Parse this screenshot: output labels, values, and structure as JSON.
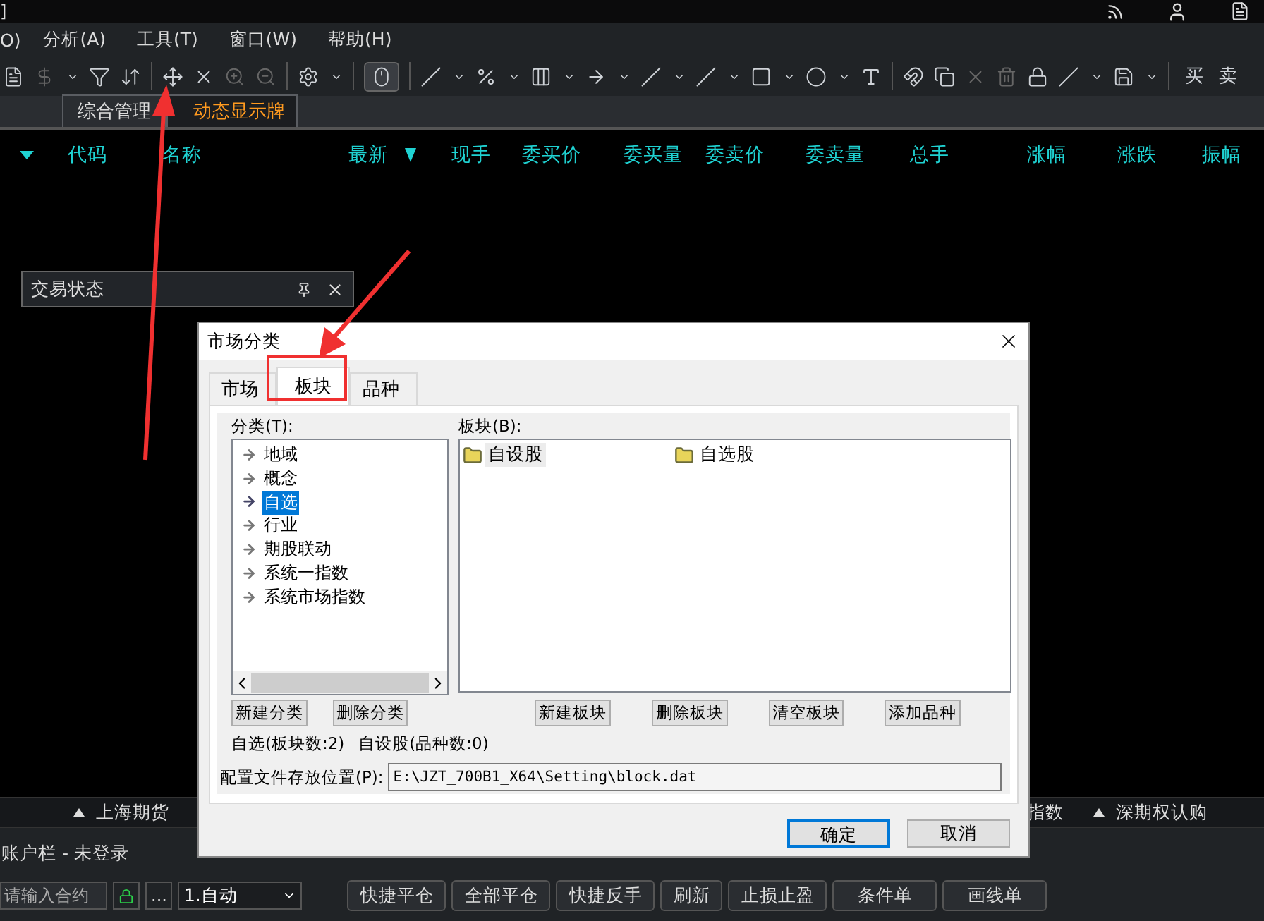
{
  "title_bar": {
    "title": "]"
  },
  "menu": [
    "O)",
    "分析(A)",
    "工具(T)",
    "窗口(W)",
    "帮助(H)"
  ],
  "toolbar": {
    "text_buttons": [
      "买",
      "卖"
    ]
  },
  "sheet_tabs": [
    {
      "label": "综合管理",
      "selected": false
    },
    {
      "label": "动态显示牌",
      "selected": true
    }
  ],
  "quote_table": {
    "columns": [
      {
        "label": "代码",
        "sorted": false
      },
      {
        "label": "名称",
        "sorted": false
      },
      {
        "label": "最新",
        "sorted": true
      },
      {
        "label": "现手",
        "sorted": false
      },
      {
        "label": "委买价",
        "sorted": false
      },
      {
        "label": "委买量",
        "sorted": false
      },
      {
        "label": "委卖价",
        "sorted": false
      },
      {
        "label": "委卖量",
        "sorted": false
      },
      {
        "label": "总手",
        "sorted": false
      },
      {
        "label": "涨幅",
        "sorted": false
      },
      {
        "label": "涨跌",
        "sorted": false
      },
      {
        "label": "振幅",
        "sorted": false
      }
    ]
  },
  "trade_status_panel": {
    "title": "交易状态"
  },
  "market_strip": [
    {
      "label": "上海期货"
    },
    {
      "label": "指数"
    },
    {
      "label": "深期权认购"
    }
  ],
  "account_bar": {
    "title": "账户栏 - 未登录"
  },
  "order_bar": {
    "contract_placeholder": "请输入合约",
    "more": "...",
    "mode": "1.自动",
    "buttons": [
      "快捷平仓",
      "全部平仓",
      "快捷反手",
      "刷新",
      "止损止盈",
      "条件单",
      "画线单"
    ]
  },
  "dialog": {
    "title": "市场分类",
    "tabs": [
      {
        "label": "市场",
        "selected": false
      },
      {
        "label": "板块",
        "selected": true
      },
      {
        "label": "品种",
        "selected": false
      }
    ],
    "category_label": "分类(T):",
    "categories": [
      {
        "label": "地域",
        "selected": false
      },
      {
        "label": "概念",
        "selected": false
      },
      {
        "label": "自选",
        "selected": true
      },
      {
        "label": "行业",
        "selected": false
      },
      {
        "label": "期股联动",
        "selected": false
      },
      {
        "label": "系统一指数",
        "selected": false
      },
      {
        "label": "系统市场指数",
        "selected": false
      }
    ],
    "block_label": "板块(B):",
    "blocks": [
      {
        "label": "自设股",
        "selected": true
      },
      {
        "label": "自选股",
        "selected": false
      }
    ],
    "category_buttons": [
      "新建分类",
      "删除分类"
    ],
    "block_buttons": [
      "新建板块",
      "删除板块",
      "清空板块",
      "添加品种"
    ],
    "status": [
      "自选(板块数:2)",
      "自设股(品种数:0)"
    ],
    "path_label": "配置文件存放位置(P):",
    "path_value": "E:\\JZT_700B1_X64\\Setting\\block.dat",
    "ok": "确定",
    "cancel": "取消"
  }
}
